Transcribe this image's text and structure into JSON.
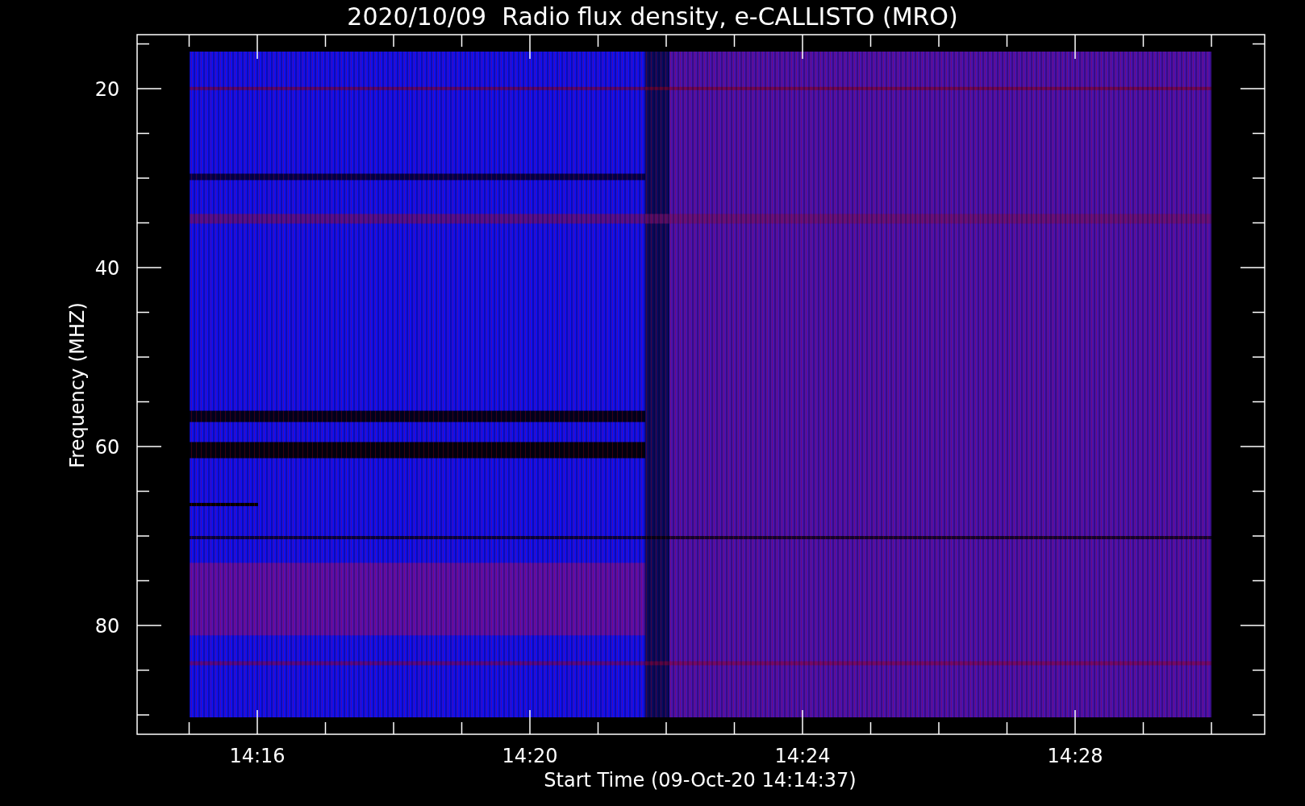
{
  "title": "2020/10/09  Radio flux density, e-CALLISTO (MRO)",
  "y_axis": {
    "label": "Frequency (MHZ)",
    "ticks": [
      "20",
      "40",
      "60",
      "80"
    ]
  },
  "x_axis": {
    "label": "Start Time (09-Oct-20 14:14:37)",
    "ticks": [
      "14:16",
      "14:20",
      "14:24",
      "14:28"
    ]
  }
}
